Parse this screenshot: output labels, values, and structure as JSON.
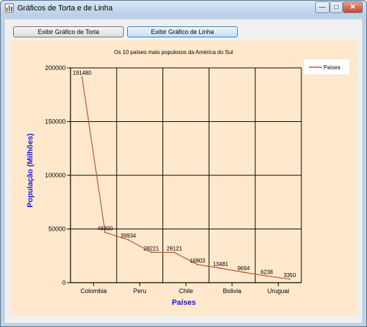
{
  "window": {
    "title": "Gráficos de Torta e de Linha",
    "min_glyph": "—",
    "max_glyph": "□",
    "close_glyph": "✕"
  },
  "toolbar": {
    "pie_button_label": "Exibir Gráfico de Torta",
    "line_button_label": "Exibir Gráfico de Linha"
  },
  "colors": {
    "panel_bg": "#ffe8cc",
    "series_line": "#b5532f",
    "axis_title": "#1a1ad0",
    "window_frame": "#bdd2e6"
  },
  "chart_data": {
    "type": "line",
    "title": "Os 10 países mais populosos da América do Sul",
    "xlabel": "Países",
    "ylabel": "População (Milhões)",
    "x_tick_labels": [
      "Colombia",
      "Peru",
      "Chile",
      "Bolivia",
      "Uruguai"
    ],
    "ylim": [
      0,
      200000
    ],
    "y_ticks": [
      0,
      50000,
      100000,
      150000,
      200000
    ],
    "grid": true,
    "legend_position": "top-right",
    "series": [
      {
        "name": "Países",
        "values": [
          191480,
          46800,
          39934,
          28221,
          28121,
          16803,
          13481,
          9694,
          6238,
          3350
        ]
      }
    ]
  }
}
